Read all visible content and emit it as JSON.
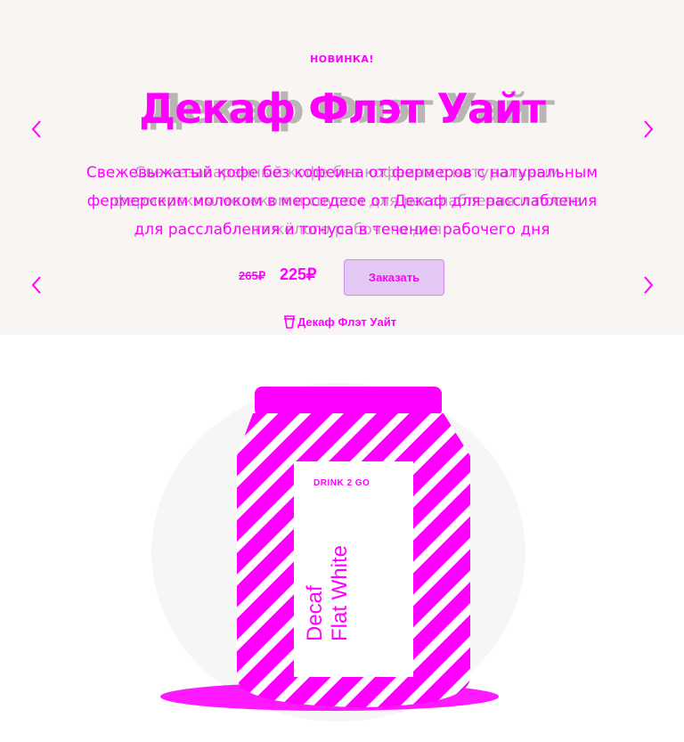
{
  "hero": {
    "badge": "НОВИНКА!",
    "title": "Декаф Флэт Уайт",
    "title_overlay": "Декаф Флэт Уайт",
    "description_line1": "Свежевыжатый кофе без кофеина от фермеров с натуральным",
    "description_line2": "фермерским молоком в мерседесе от Декаф для расслабления",
    "description_line3": "для расслабления и тонуса в течение рабочего дня",
    "description_overlay_line1": "Свежезаваренный кофе без кофеина с натуральным",
    "description_overlay_line2": "фермерским молоком и соусом для расслабления и после",
    "description_overlay_line3": "тяжёлого рабочего дня",
    "price_old": "265₽",
    "price_new": "225₽",
    "order_button": "Заказать",
    "product_link": "Декаф Флэт Уайт"
  },
  "product": {
    "brand": "DRINK 2 GO",
    "can_text_line1": "Decaf",
    "can_text_line2": "Flat White"
  },
  "icons": {
    "prev": "chevron-left-icon",
    "next": "chevron-right-icon",
    "link": "cup-icon"
  },
  "colors": {
    "accent": "#ff00ff",
    "hero_bg": "#f8f5f3",
    "button_bg": "#e4c8f4"
  }
}
